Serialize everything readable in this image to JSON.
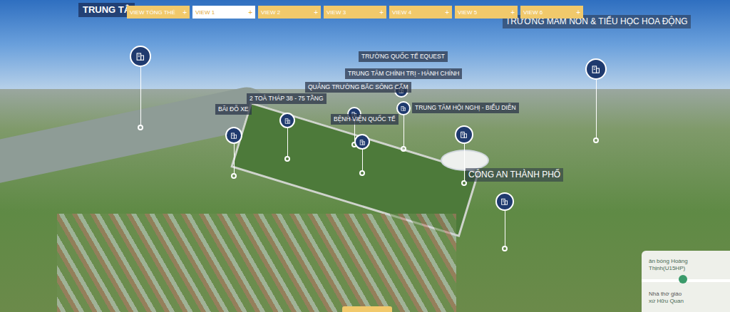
{
  "title": "TRUNG TÂ",
  "tabs": [
    {
      "label": "VIEW TỔNG THỂ",
      "icon": "+",
      "selected": false
    },
    {
      "label": "VIEW 1",
      "icon": "+",
      "selected": true
    },
    {
      "label": "VIEW 2",
      "icon": "+",
      "selected": false
    },
    {
      "label": "VIEW 3",
      "icon": "+",
      "selected": false
    },
    {
      "label": "VIEW 4",
      "icon": "+",
      "selected": false
    },
    {
      "label": "VIEW 5",
      "icon": "+",
      "selected": false
    },
    {
      "label": "VIEW 6",
      "icon": "+",
      "selected": false
    }
  ],
  "labels": [
    "TRƯỜNG QUỐC TẾ EQUEST",
    "TRUNG TÂM CHÍNH TRỊ - HÀNH CHÍNH",
    "2 TOÀ THÁP 38 - 75 TẦNG",
    "QUẢNG TRƯỜNG BẮC SÔNG CẤM",
    "BÃI ĐỖ XE",
    "BỆNH VIỆN QUỐC TẾ",
    "TRUNG TÂM HỘI NGHỊ - BIỂU DIỄN"
  ],
  "big_labels": [
    "CÔNG AN THÀNH PHỐ",
    "TRƯỜNG MẦM NON & TIỂU HỌC HOA ĐỘNG"
  ],
  "map_inset": {
    "lines": [
      "ân bóng Hoàng",
      "Thịnh(U15HP)",
      "Nhà thờ giáo",
      "xứ Hữu Quan"
    ]
  }
}
